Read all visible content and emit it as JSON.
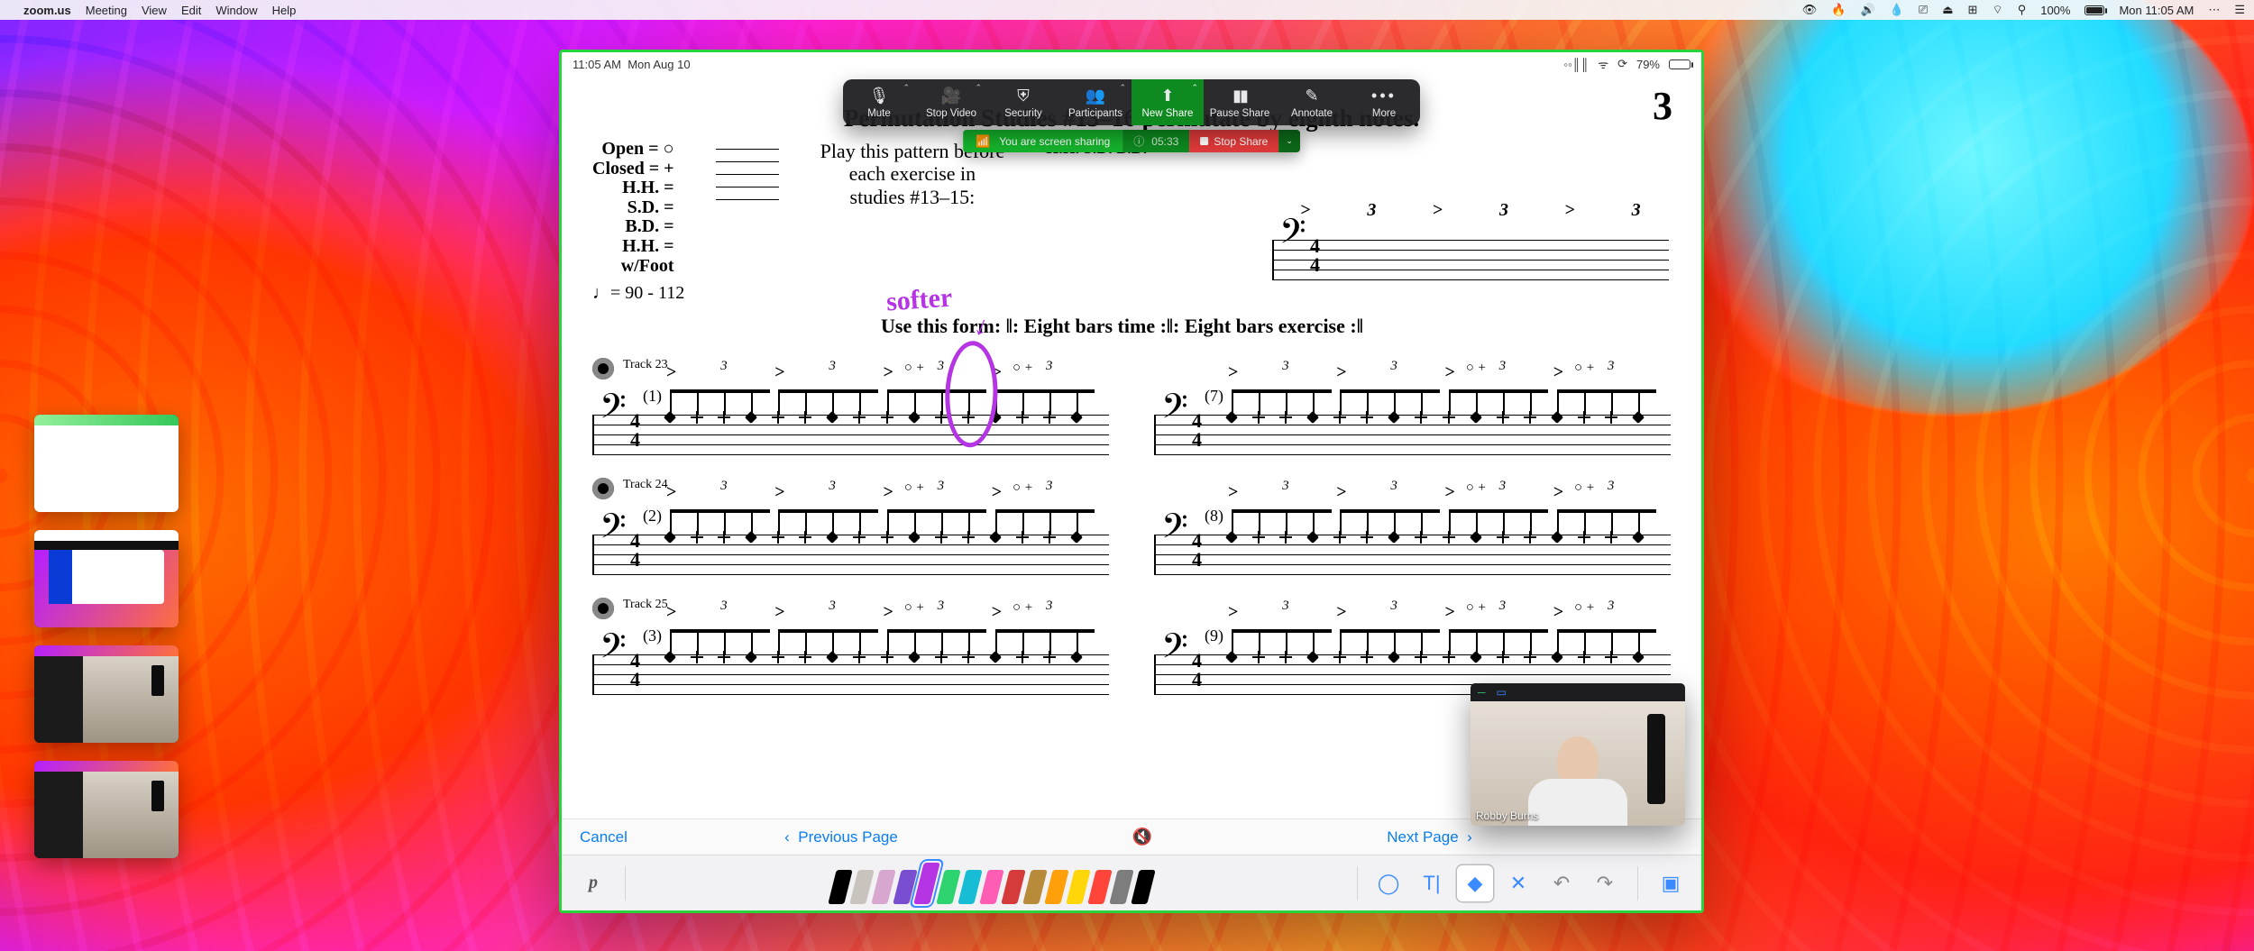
{
  "mac": {
    "app_name": "zoom.us",
    "menu": [
      "Meeting",
      "View",
      "Edit",
      "Window",
      "Help"
    ],
    "battery_text": "100%",
    "clock": "Mon 11:05 AM"
  },
  "ipad_status": {
    "time": "11:05 AM",
    "date": "Mon Aug 10",
    "battery": "79%"
  },
  "zoom": {
    "mute": "Mute",
    "stop_video": "Stop Video",
    "security": "Security",
    "participants": "Participants",
    "new_share": "New Share",
    "pause_share": "Pause Share",
    "annotate": "Annotate",
    "more": "More",
    "sharing_msg": "You are screen sharing",
    "meeting_id": "05:33",
    "stop_share": "Stop Share"
  },
  "doc": {
    "big_number": "3",
    "title": "Permutation Studies #13–16 permutate by eighth notes.",
    "legend_keys": "Open = ○\nClosed = +\nH.H. =\nS.D. =\nB.D. =\nH.H. =\nw/Foot",
    "instruction": "Play this pattern before\neach exercise in\nstudies #13–15:",
    "stave_labels": "H.H.\nS.D.\nB.D.",
    "time_sig_top": "4",
    "time_sig_bot": "4",
    "tempo": "♩= 90 - 112",
    "use_form": "Use this form:  ‖: Eight bars time :‖: Eight bars exercise :‖",
    "tracks": [
      {
        "label": "Track 23",
        "left_num": "(1)",
        "right_num": "(7)"
      },
      {
        "label": "Track 24",
        "left_num": "(2)",
        "right_num": "(8)"
      },
      {
        "label": "Track 25",
        "left_num": "(3)",
        "right_num": "(9)"
      }
    ],
    "annotation_text": "softer"
  },
  "docnav": {
    "cancel": "Cancel",
    "prev": "Previous Page",
    "next": "Next Page"
  },
  "pens": {
    "dynamic": "p",
    "colors": [
      "#000000",
      "#c9c3bd",
      "#d7a7d0",
      "#7a4ed0",
      "#b534e3",
      "#2dd36f",
      "#17bdd4",
      "#ff5cb3",
      "#d63b3b",
      "#b88b3a",
      "#ff9f0a",
      "#ffd60a",
      "#ff453a",
      "#7d7d7d",
      "#000000"
    ]
  },
  "webcam": {
    "name": "Robby Burns"
  }
}
